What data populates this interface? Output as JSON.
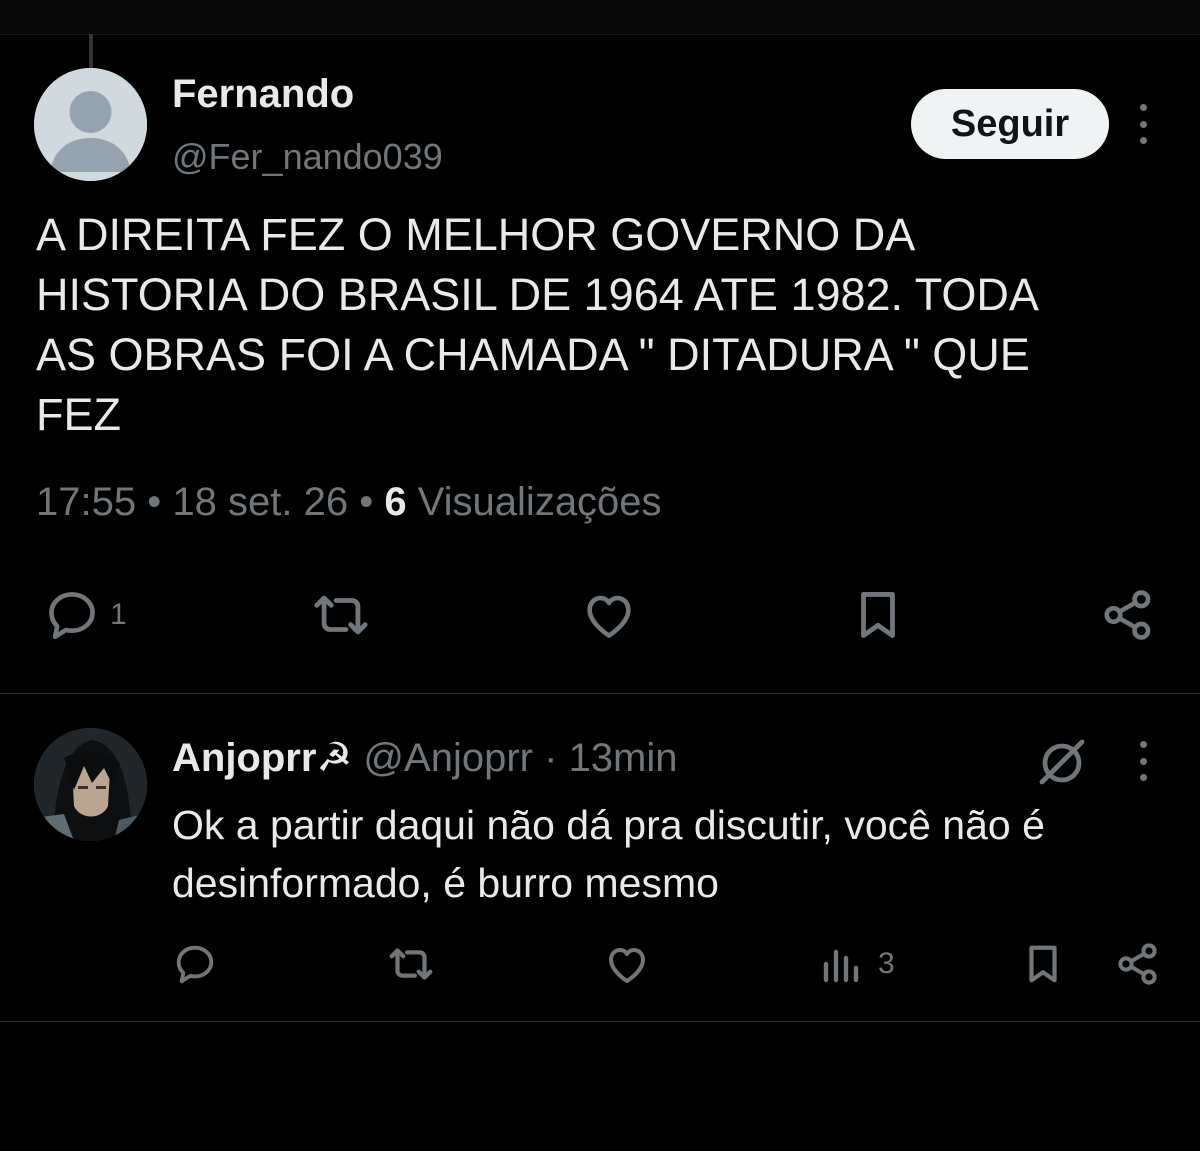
{
  "tweet": {
    "author_name": "Fernando",
    "author_handle": "@Fer_nando039",
    "follow_label": "Seguir",
    "text_lines": [
      "A DIREITA FEZ O MELHOR GOVERNO DA",
      "HISTORIA DO BRASIL DE 1964 ATE 1982. TODA",
      "AS OBRAS FOI A CHAMADA \" DITADURA \" QUE",
      "FEZ"
    ],
    "time": "17:55",
    "date": "18 set. 26",
    "views_count": "6",
    "views_label": "Visualizações",
    "separator": "•",
    "reply_count": "1",
    "icons": [
      "reply-icon",
      "retweet-icon",
      "like-icon",
      "bookmark-icon",
      "share-icon"
    ]
  },
  "reply": {
    "author_name": "Anjoprr☭",
    "author_handle": "@Anjoprr",
    "separator": "·",
    "age": "13min",
    "text_lines": [
      "Ok a partir daqui não dá pra discutir, você não é",
      "desinformado, é burro mesmo"
    ],
    "views_count": "3",
    "icons": [
      "reply-icon",
      "retweet-icon",
      "like-icon",
      "views-icon",
      "bookmark-icon",
      "share-icon",
      "grok-icon",
      "more-icon"
    ]
  },
  "colors": {
    "background": "#000000",
    "text_primary": "#e7e9ea",
    "text_secondary": "#71767b",
    "divider": "#2f3336",
    "button_bg": "#eff3f4"
  }
}
